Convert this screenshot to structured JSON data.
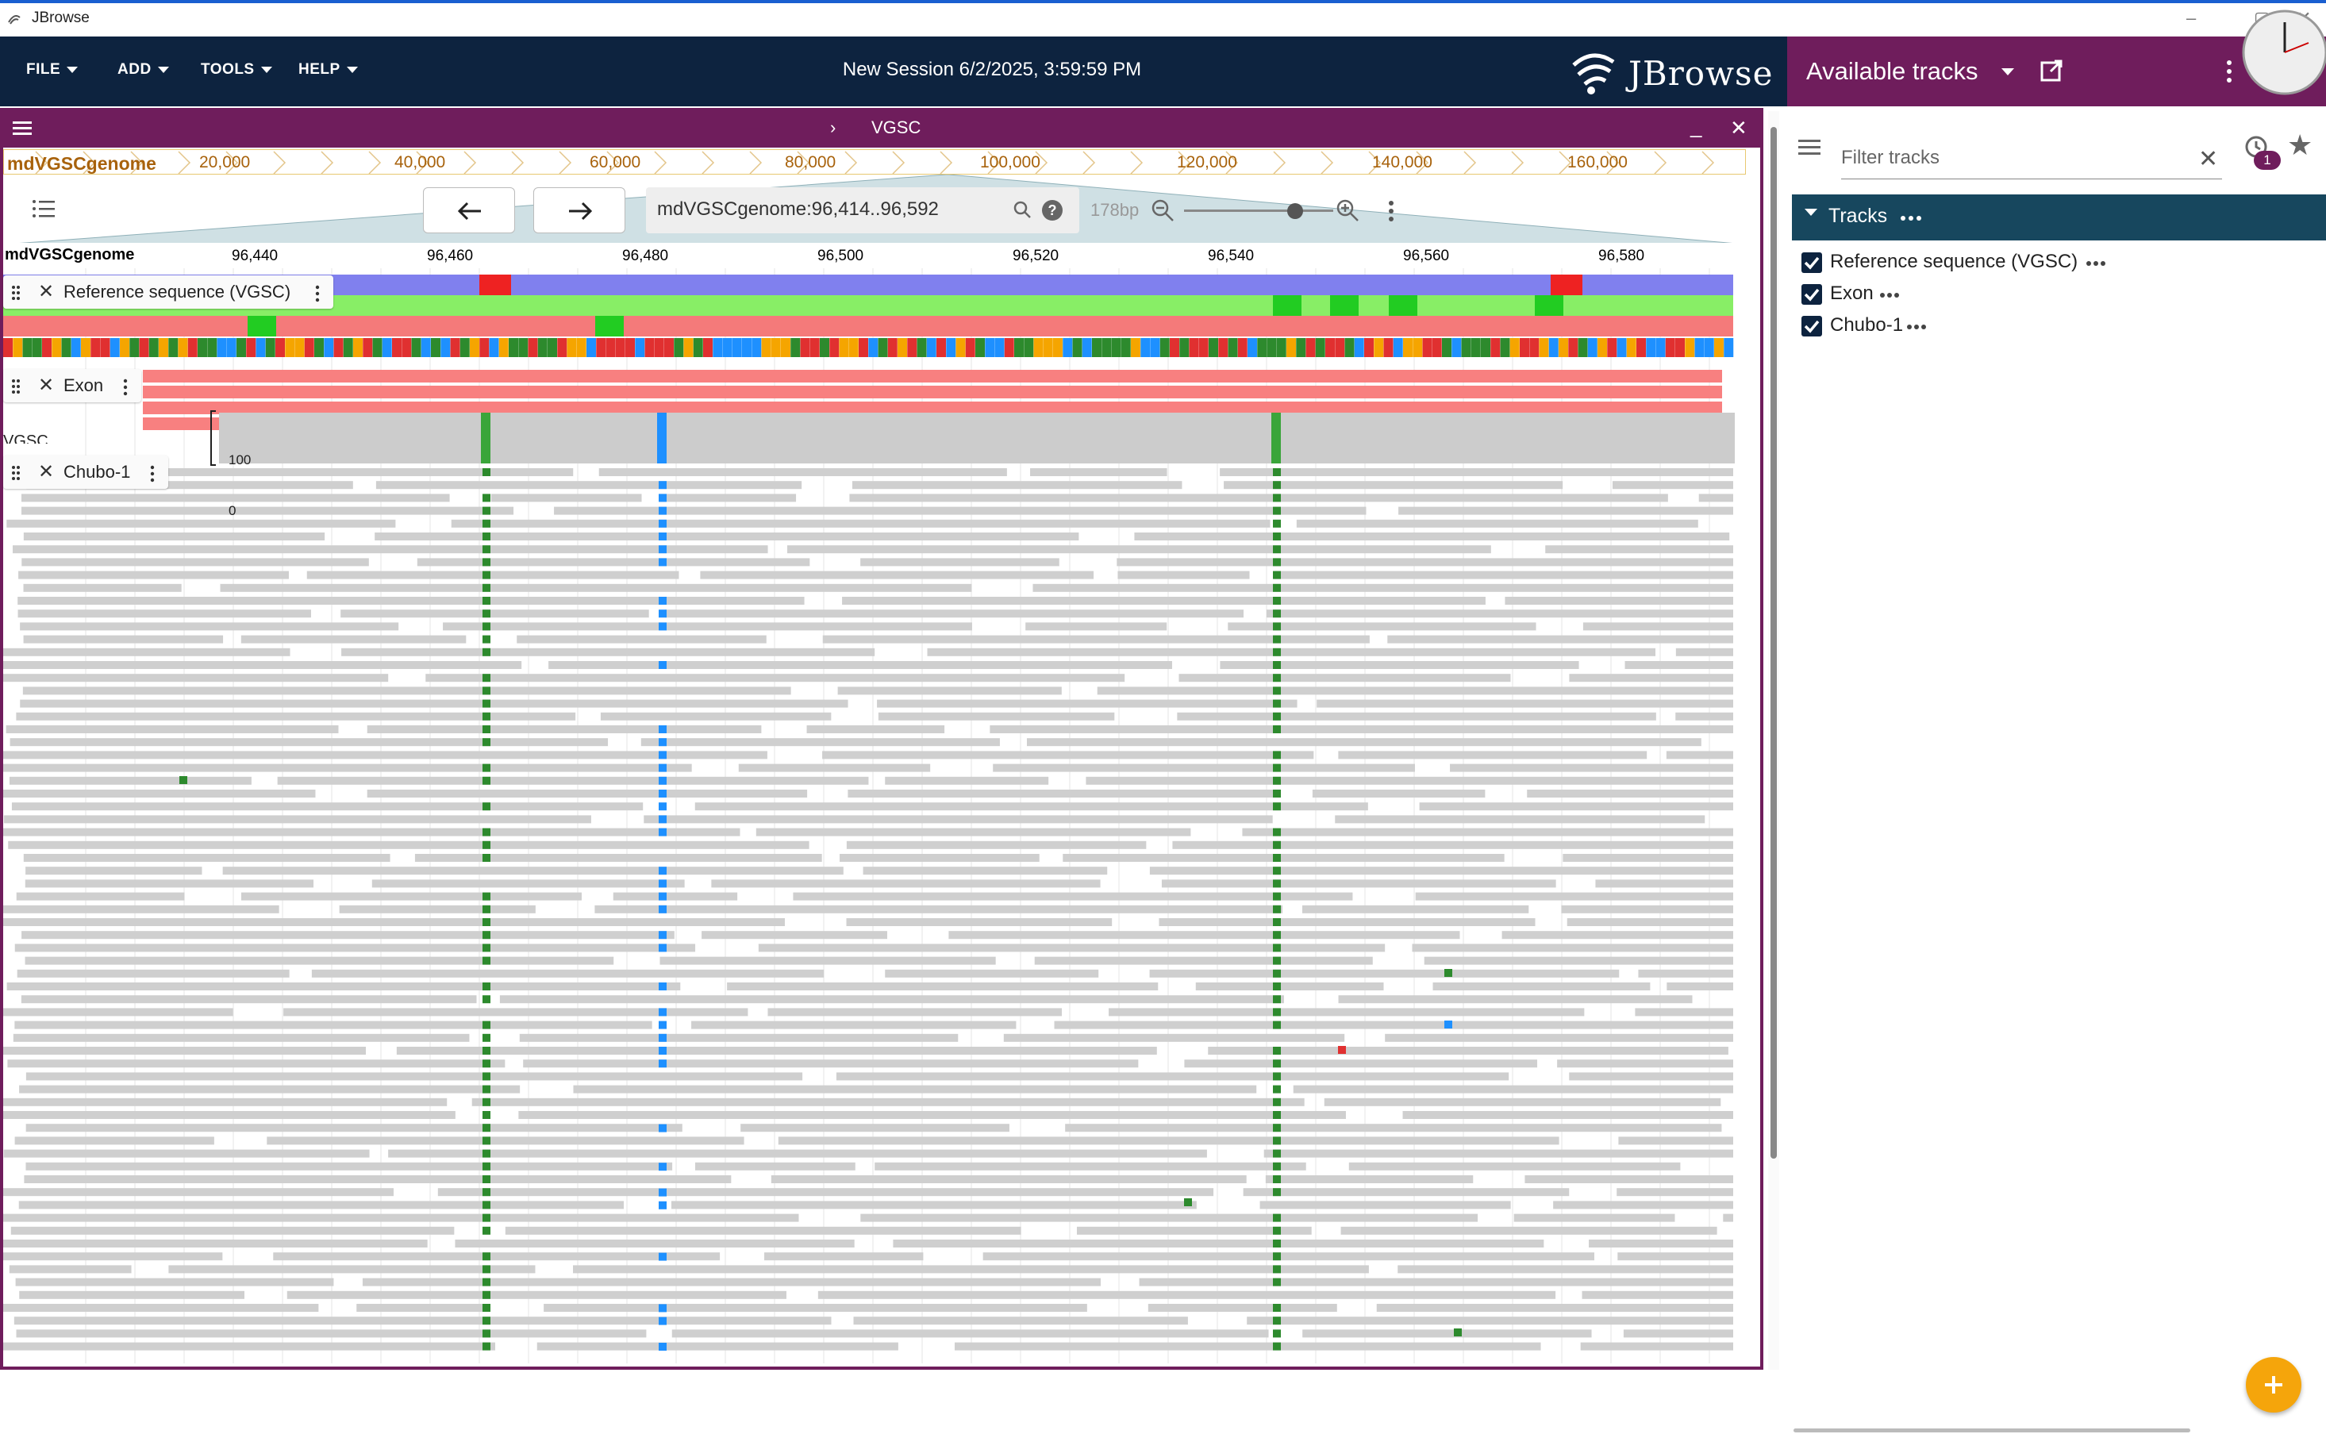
{
  "window": {
    "title": "JBrowse"
  },
  "menu": {
    "file": "FILE",
    "add": "ADD",
    "tools": "TOOLS",
    "help": "HELP"
  },
  "session": {
    "title": "New Session 6/2/2025, 3:59:59 PM"
  },
  "logo": {
    "text": "JBrowse"
  },
  "view": {
    "name": "VGSC"
  },
  "overview": {
    "assembly": "mdVGSCgenome",
    "ticks": [
      "20,000",
      "40,000",
      "60,000",
      "80,000",
      "100,000",
      "120,000",
      "140,000",
      "160,000"
    ]
  },
  "nav": {
    "location": "mdVGSCgenome:96,414..96,592",
    "bp": "178bp"
  },
  "ruler": {
    "refname": "mdVGSCgenome",
    "ticks": [
      "96,440",
      "96,460",
      "96,480",
      "96,500",
      "96,520",
      "96,540",
      "96,560",
      "96,580"
    ]
  },
  "tracks": {
    "ref": {
      "label": "Reference sequence (VGSC)"
    },
    "exon": {
      "label": "Exon",
      "overflow": "VGSC"
    },
    "chubo": {
      "label": "Chubo-1",
      "ymax": "100",
      "ymin": "0"
    }
  },
  "drawer": {
    "title": "Available tracks",
    "filter_placeholder": "Filter tracks",
    "history_badge": "1",
    "section": "Tracks",
    "items": [
      {
        "label": "Reference sequence (VGSC)",
        "checked": true
      },
      {
        "label": "Exon",
        "checked": true
      },
      {
        "label": "Chubo-1",
        "checked": true
      }
    ]
  },
  "colors": {
    "appbar": "#0d233f",
    "view_header": "#6f1d5c",
    "tracks_header": "#17475e",
    "snp_A": "#2d8a2d",
    "snp_C": "#1e90ff",
    "snp_T": "#e03030",
    "fab": "#f5a50b"
  }
}
